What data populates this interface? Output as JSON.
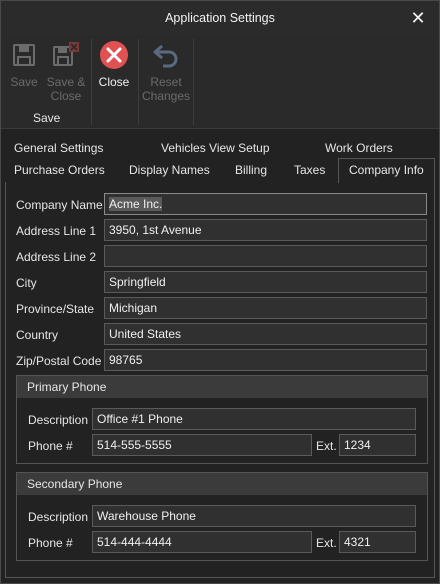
{
  "window": {
    "title": "Application Settings"
  },
  "ribbon": {
    "save": "Save",
    "save_close_line1": "Save &",
    "save_close_line2": "Close",
    "close": "Close",
    "reset_line1": "Reset",
    "reset_line2": "Changes",
    "group_label": "Save"
  },
  "tabs": {
    "row1": [
      "General Settings",
      "Vehicles View Setup",
      "Work Orders"
    ],
    "row2": [
      "Purchase Orders",
      "Display Names",
      "Billing",
      "Taxes",
      "Company Info"
    ],
    "active": "Company Info"
  },
  "form": {
    "company_name_label": "Company Name",
    "company_name": "Acme Inc.",
    "address1_label": "Address Line 1",
    "address1": "3950, 1st Avenue",
    "address2_label": "Address Line 2",
    "address2": "",
    "city_label": "City",
    "city": "Springfield",
    "province_label": "Province/State",
    "province": "Michigan",
    "country_label": "Country",
    "country": "United States",
    "zip_label": "Zip/Postal Code",
    "zip": "98765"
  },
  "primary_phone": {
    "header": "Primary Phone",
    "description_label": "Description",
    "description": "Office #1 Phone",
    "phone_label": "Phone #",
    "phone": "514-555-5555",
    "ext_label": "Ext.",
    "ext": "1234"
  },
  "secondary_phone": {
    "header": "Secondary Phone",
    "description_label": "Description",
    "description": "Warehouse Phone",
    "phone_label": "Phone #",
    "phone": "514-444-4444",
    "ext_label": "Ext.",
    "ext": "4321"
  },
  "colors": {
    "close_icon": "#e05252",
    "disabled": "#6b6b6b"
  }
}
